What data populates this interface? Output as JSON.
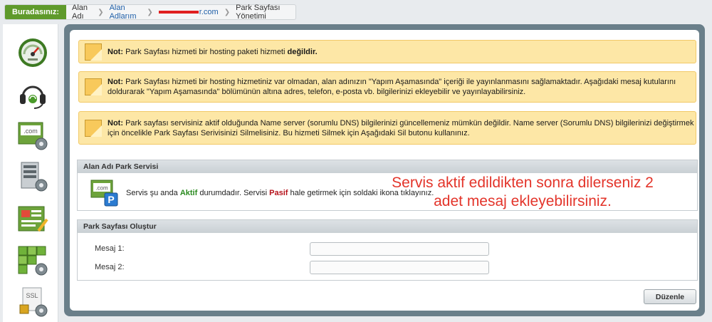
{
  "breadcrumb": {
    "here": "Buradasınız:",
    "items": [
      "Alan Adı",
      "Alan Adlarım",
      "r.com",
      "Park Sayfası Yönetimi"
    ]
  },
  "sidebar": {
    "icons": [
      "speedometer-icon",
      "headset-support-icon",
      "domain-settings-icon",
      "server-settings-icon",
      "content-edit-icon",
      "hosting-cubes-icon",
      "ssl-settings-icon"
    ]
  },
  "notes": [
    {
      "label": "Not:",
      "text": "Park Sayfası hizmeti bir hosting paketi hizmeti ",
      "emphasis": "değildir."
    },
    {
      "label": "Not:",
      "text": "Park Sayfası hizmeti bir hosting hizmetiniz var olmadan, alan adınızın \"Yapım Aşamasında\" içeriği ile yayınlanmasını sağlamaktadır. Aşağıdaki mesaj kutularını doldurarak \"Yapım Aşamasında\" bölümünün altına adres, telefon, e-posta vb. bilgilerinizi ekleyebilir ve yayınlayabilirsiniz."
    },
    {
      "label": "Not:",
      "text": " Park sayfası servisiniz aktif olduğunda Name server (sorumlu DNS) bilgilerinizi güncellemeniz mümkün değildir. Name server  (Sorumlu DNS) bilgilerinizi değiştirmek için öncelikle Park Sayfası Serivisinizi Silmelisiniz. Bu hizmeti Silmek için Aşağıdaki Sil butonu  kullanınız."
    }
  ],
  "park_service": {
    "header": "Alan Adı Park Servisi",
    "status_prefix": "Servis şu anda ",
    "status_active": "Aktif",
    "status_mid": " durumdadır. Servisi ",
    "status_passive": "Pasif",
    "status_suffix": " hale getirmek için soldaki ikona tıklayınız.",
    "icon_text": ".com",
    "icon_badge": "P",
    "active_color": "#2a8a1f",
    "passive_color": "#b5121b"
  },
  "overlay": {
    "line1": "Servis aktif edildikten sonra dilerseniz 2",
    "line2": "adet mesaj ekleyebilirsiniz."
  },
  "park_create": {
    "header": "Park Sayfası Oluştur",
    "message1_label": "Mesaj 1:",
    "message1_value": "",
    "message2_label": "Mesaj 2:",
    "message2_value": ""
  },
  "buttons": {
    "edit": "Düzenle"
  }
}
